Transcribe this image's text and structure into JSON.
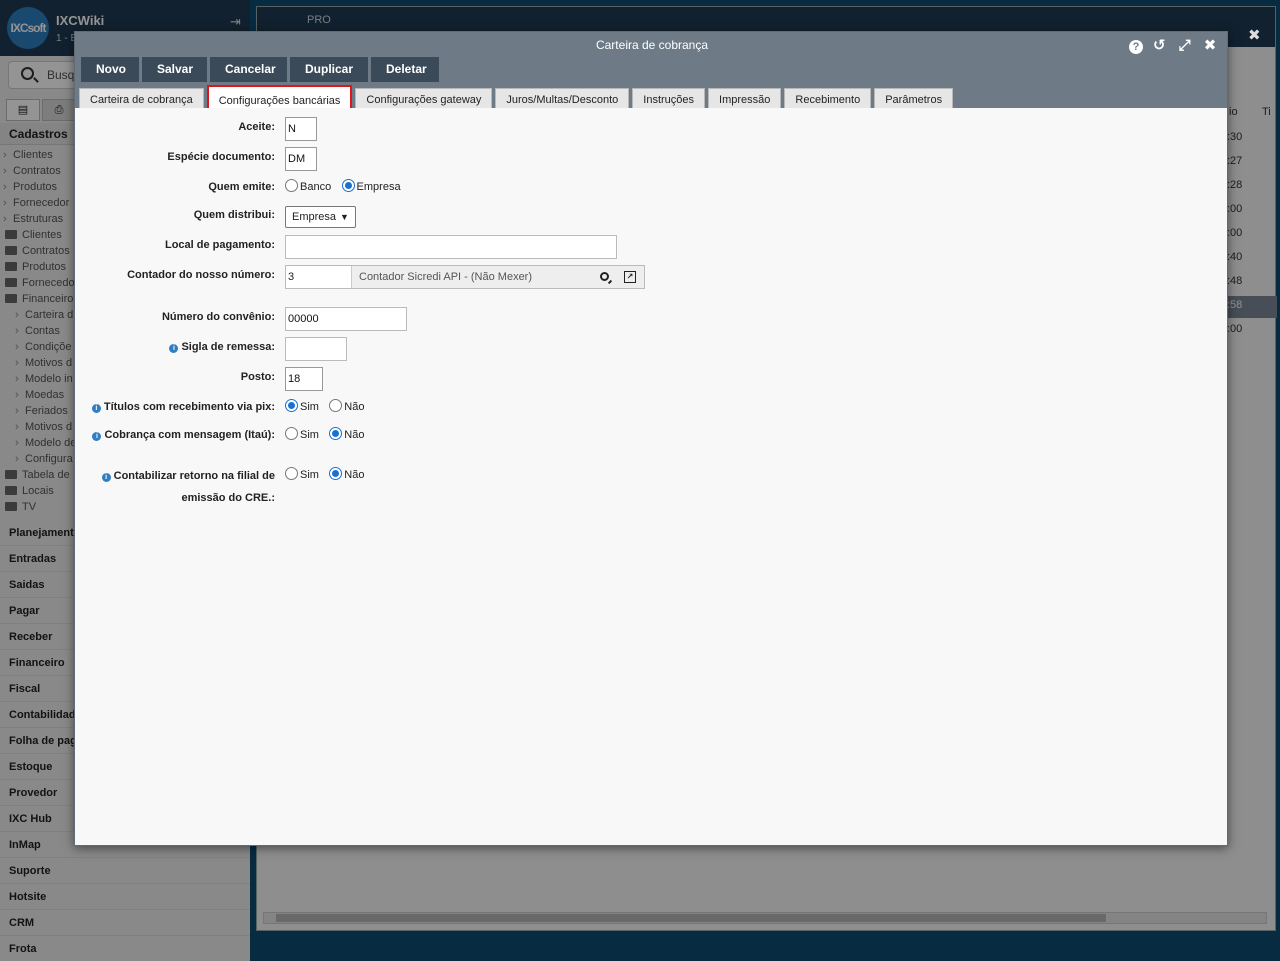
{
  "sidebar": {
    "logo_text": "IXCsoft",
    "app_name": "IXCWiki",
    "app_sub": "1 - E",
    "search_placeholder": "Busq",
    "section_title": "Cadastros",
    "tree": [
      {
        "label": "Clientes",
        "kind": "chev",
        "level": "l0"
      },
      {
        "label": "Contratos",
        "kind": "chev",
        "level": "l0"
      },
      {
        "label": "Produtos",
        "kind": "chev",
        "level": "l0"
      },
      {
        "label": "Fornecedor",
        "kind": "chev",
        "level": "l0"
      },
      {
        "label": "Estruturas",
        "kind": "chev",
        "level": "l0"
      },
      {
        "label": "Clientes",
        "kind": "folder",
        "level": "l0f"
      },
      {
        "label": "Contratos",
        "kind": "folder",
        "level": "l0f"
      },
      {
        "label": "Produtos",
        "kind": "folder",
        "level": "l0f"
      },
      {
        "label": "Fornecedo",
        "kind": "folder",
        "level": "l0f"
      },
      {
        "label": "Financeiro",
        "kind": "folder",
        "level": "l0f"
      },
      {
        "label": "Carteira d",
        "kind": "chev",
        "level": "l1"
      },
      {
        "label": "Contas",
        "kind": "chev",
        "level": "l1"
      },
      {
        "label": "Condiçõe",
        "kind": "chev",
        "level": "l1"
      },
      {
        "label": "Motivos d",
        "kind": "chev",
        "level": "l1"
      },
      {
        "label": "Modelo in",
        "kind": "chev",
        "level": "l1"
      },
      {
        "label": "Moedas",
        "kind": "chev",
        "level": "l1"
      },
      {
        "label": "Feriados",
        "kind": "chev",
        "level": "l1"
      },
      {
        "label": "Motivos d",
        "kind": "chev",
        "level": "l1"
      },
      {
        "label": "Modelo de",
        "kind": "chev",
        "level": "l1"
      },
      {
        "label": "Configura",
        "kind": "chev",
        "level": "l1"
      },
      {
        "label": "Tabela de",
        "kind": "folder",
        "level": "l0f"
      },
      {
        "label": "Locais",
        "kind": "folder",
        "level": "l0f"
      },
      {
        "label": "TV",
        "kind": "folder",
        "level": "l0f"
      }
    ],
    "menu": [
      "Planejament",
      "Entradas",
      "Saidas",
      "Pagar",
      "Receber",
      "Financeiro",
      "Fiscal",
      "Contabilidad",
      "Folha de pag",
      "Estoque",
      "Provedor",
      "IXC Hub",
      "InMap",
      "Suporte",
      "Hotsite",
      "CRM",
      "Frota"
    ]
  },
  "background": {
    "top_label": "PRO",
    "cells": [
      ":30",
      ":27",
      ":28",
      ":00",
      ":00",
      ":40",
      ":48",
      ":58",
      ":00"
    ],
    "col_header_1": "io",
    "col_header_2": "Ti"
  },
  "modal": {
    "title": "Carteira de cobrança",
    "tools": {
      "help": "?",
      "reset": "↺",
      "expand": "⤢",
      "close": "✖"
    },
    "outer_close": "✖",
    "toolbar": [
      "Novo",
      "Salvar",
      "Cancelar",
      "Duplicar",
      "Deletar"
    ],
    "tabs": [
      "Carteira de cobrança",
      "Configurações bancárias",
      "Configurações gateway",
      "Juros/Multas/Desconto",
      "Instruções",
      "Impressão",
      "Recebimento",
      "Parâmetros"
    ],
    "active_tab": 1
  },
  "form": {
    "aceite": {
      "label": "Aceite:",
      "value": "N"
    },
    "especie": {
      "label": "Espécie documento:",
      "value": "DM"
    },
    "quem_emite": {
      "label": "Quem emite:",
      "opt1": "Banco",
      "opt2": "Empresa",
      "selected": "Empresa"
    },
    "quem_distribui": {
      "label": "Quem distribui:",
      "value": "Empresa"
    },
    "local_pagamento": {
      "label": "Local de pagamento:",
      "value": ""
    },
    "contador": {
      "label": "Contador do nosso número:",
      "value": "3",
      "description": "Contador Sicredi API - (Não Mexer)"
    },
    "convenio": {
      "label": "Número do convênio:",
      "value": "00000"
    },
    "sigla": {
      "label": "Sigla de remessa:",
      "value": ""
    },
    "posto": {
      "label": "Posto:",
      "value": "18"
    },
    "pix": {
      "label": "Títulos com recebimento via pix:",
      "opt1": "Sim",
      "opt2": "Não",
      "selected": "Sim"
    },
    "mensagem": {
      "label": "Cobrança com mensagem (Itaú):",
      "opt1": "Sim",
      "opt2": "Não",
      "selected": "Não"
    },
    "contabilizar": {
      "label_line1": "Contabilizar retorno na filial de",
      "label_line2": "emissão do CRE.:",
      "opt1": "Sim",
      "opt2": "Não",
      "selected": "Não"
    }
  }
}
